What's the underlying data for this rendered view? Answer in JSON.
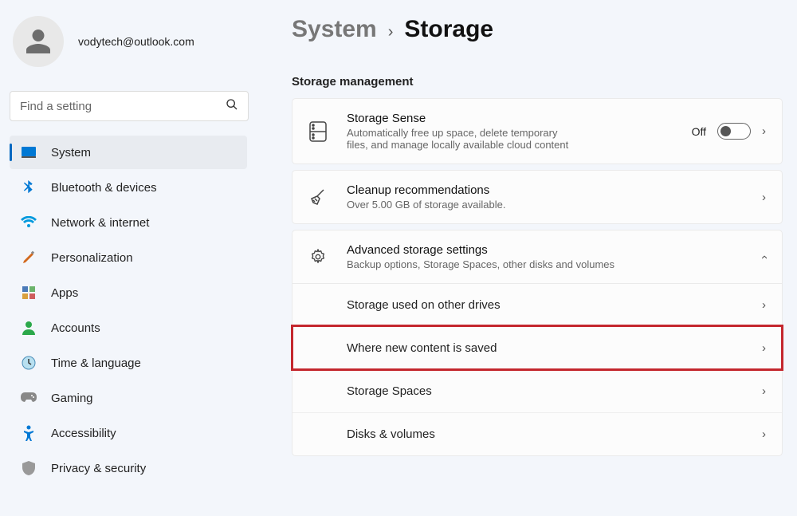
{
  "user": {
    "email": "vodytech@outlook.com"
  },
  "search": {
    "placeholder": "Find a setting"
  },
  "nav": {
    "items": [
      {
        "label": "System"
      },
      {
        "label": "Bluetooth & devices"
      },
      {
        "label": "Network & internet"
      },
      {
        "label": "Personalization"
      },
      {
        "label": "Apps"
      },
      {
        "label": "Accounts"
      },
      {
        "label": "Time & language"
      },
      {
        "label": "Gaming"
      },
      {
        "label": "Accessibility"
      },
      {
        "label": "Privacy & security"
      }
    ]
  },
  "breadcrumb": {
    "parent": "System",
    "current": "Storage"
  },
  "section": {
    "title": "Storage management",
    "storage_sense": {
      "title": "Storage Sense",
      "sub": "Automatically free up space, delete temporary files, and manage locally available cloud content",
      "toggle_label": "Off"
    },
    "cleanup": {
      "title": "Cleanup recommendations",
      "sub": "Over 5.00 GB of storage available."
    },
    "advanced": {
      "title": "Advanced storage settings",
      "sub": "Backup options, Storage Spaces, other disks and volumes",
      "items": [
        {
          "label": "Storage used on other drives"
        },
        {
          "label": "Where new content is saved"
        },
        {
          "label": "Storage Spaces"
        },
        {
          "label": "Disks & volumes"
        }
      ]
    }
  }
}
